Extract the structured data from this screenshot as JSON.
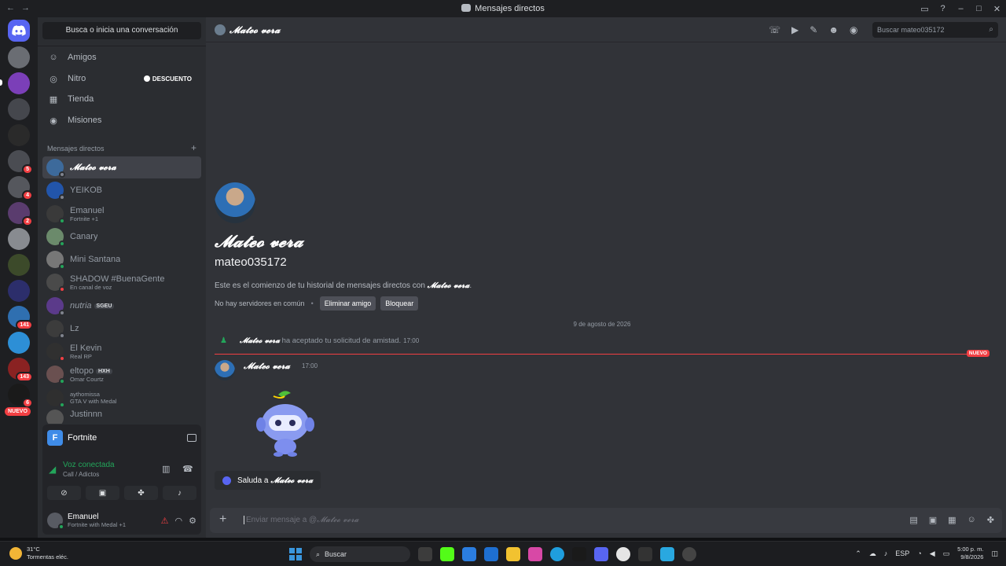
{
  "window": {
    "title": "Mensajes directos"
  },
  "sidebar": {
    "search_label": "Busca o inicia una conversación",
    "nav": [
      {
        "label": "Amigos",
        "icon": "friends-icon"
      },
      {
        "label": "Nitro",
        "icon": "nitro-icon",
        "badge": "DESCUENTO"
      },
      {
        "label": "Tienda",
        "icon": "shop-icon"
      },
      {
        "label": "Misiones",
        "icon": "quests-icon"
      }
    ],
    "dm_header": "Mensajes directos",
    "dm_add": "+",
    "dms": [
      {
        "name": "𝓜𝓪𝓽𝓮𝓸 𝓿𝓮𝓻𝓪",
        "sub": "",
        "status": "offline",
        "active": true
      },
      {
        "name": "YEIKOB",
        "sub": "",
        "status": "offline"
      },
      {
        "name": "Emanuel",
        "sub": "Fortnite +1",
        "status": "online"
      },
      {
        "name": "Canary",
        "sub": "",
        "status": "online"
      },
      {
        "name": "Mini Santana",
        "sub": "",
        "status": "online"
      },
      {
        "name": "SHADOW #BuenaGente",
        "sub": "En canal de voz",
        "status": "dnd"
      },
      {
        "name": "nutria",
        "tag": "SGEU",
        "sub": "",
        "status": "offline"
      },
      {
        "name": "Lz",
        "sub": "",
        "status": "offline"
      },
      {
        "name": "El Kevin",
        "sub": "Real RP",
        "status": "dnd"
      },
      {
        "name": "eltopo",
        "tag": "HXH",
        "sub": "Omar Courtz",
        "status": "online"
      },
      {
        "name": "aythomissa",
        "sub": "GTA V with Medal",
        "status": "online"
      },
      {
        "name": "Justinnn",
        "sub": "",
        "status": "offline"
      }
    ]
  },
  "rail": {
    "nuevo": "NUEVO",
    "badges": [
      "5",
      "4",
      "2",
      "141",
      "143",
      "6"
    ]
  },
  "panel": {
    "game": "Fortnite",
    "voice_title": "Voz conectada",
    "voice_sub": "Call / Adictos",
    "user_name": "Emanuel",
    "user_status": "Fortnite with Medal +1"
  },
  "chat": {
    "header_name": "𝓜𝓪𝓽𝓮𝓸 𝓿𝓮𝓻𝓪",
    "search_placeholder": "Buscar mateo035172",
    "intro_name": "𝓜𝓪𝓽𝓮𝓸 𝓿𝓮𝓻𝓪",
    "intro_username": "mateo035172",
    "intro_desc_prefix": "Este es el comienzo de tu historial de mensajes directos con ",
    "intro_desc_name": "𝓜𝓪𝓽𝓮𝓸 𝓿𝓮𝓻𝓪",
    "intro_desc_suffix": ".",
    "no_servers": "No hay servidores en común",
    "remove_friend": "Eliminar amigo",
    "block": "Bloquear",
    "date_separator": "9 de agosto de 2026",
    "system_author": "𝓜𝓪𝓽𝓮𝓸 𝓿𝓮𝓻𝓪",
    "system_text": "ha aceptado tu solicitud de amistad.",
    "system_time": "17:00",
    "new_label": "NUEVO",
    "message_author": "𝓜𝓪𝓽𝓮𝓸 𝓿𝓮𝓻𝓪",
    "message_time": "17:00",
    "wave_prefix": "Saluda a",
    "wave_name": "𝓜𝓪𝓽𝓮𝓸 𝓿𝓮𝓻𝓪",
    "composer_placeholder_prefix": "Enviar mensaje a @",
    "composer_placeholder_name": "𝓜𝓪𝓽𝓮𝓸 𝓿𝓮𝓻𝓪"
  },
  "taskbar": {
    "temp": "31°C",
    "weather": "Tormentas eléc.",
    "search": "Buscar",
    "lang": "ESP",
    "time": "5:00 p. m.",
    "date": "9/8/2026"
  },
  "colors": {
    "accent": "#5865f2",
    "online": "#23a55a",
    "danger": "#f23f43"
  }
}
